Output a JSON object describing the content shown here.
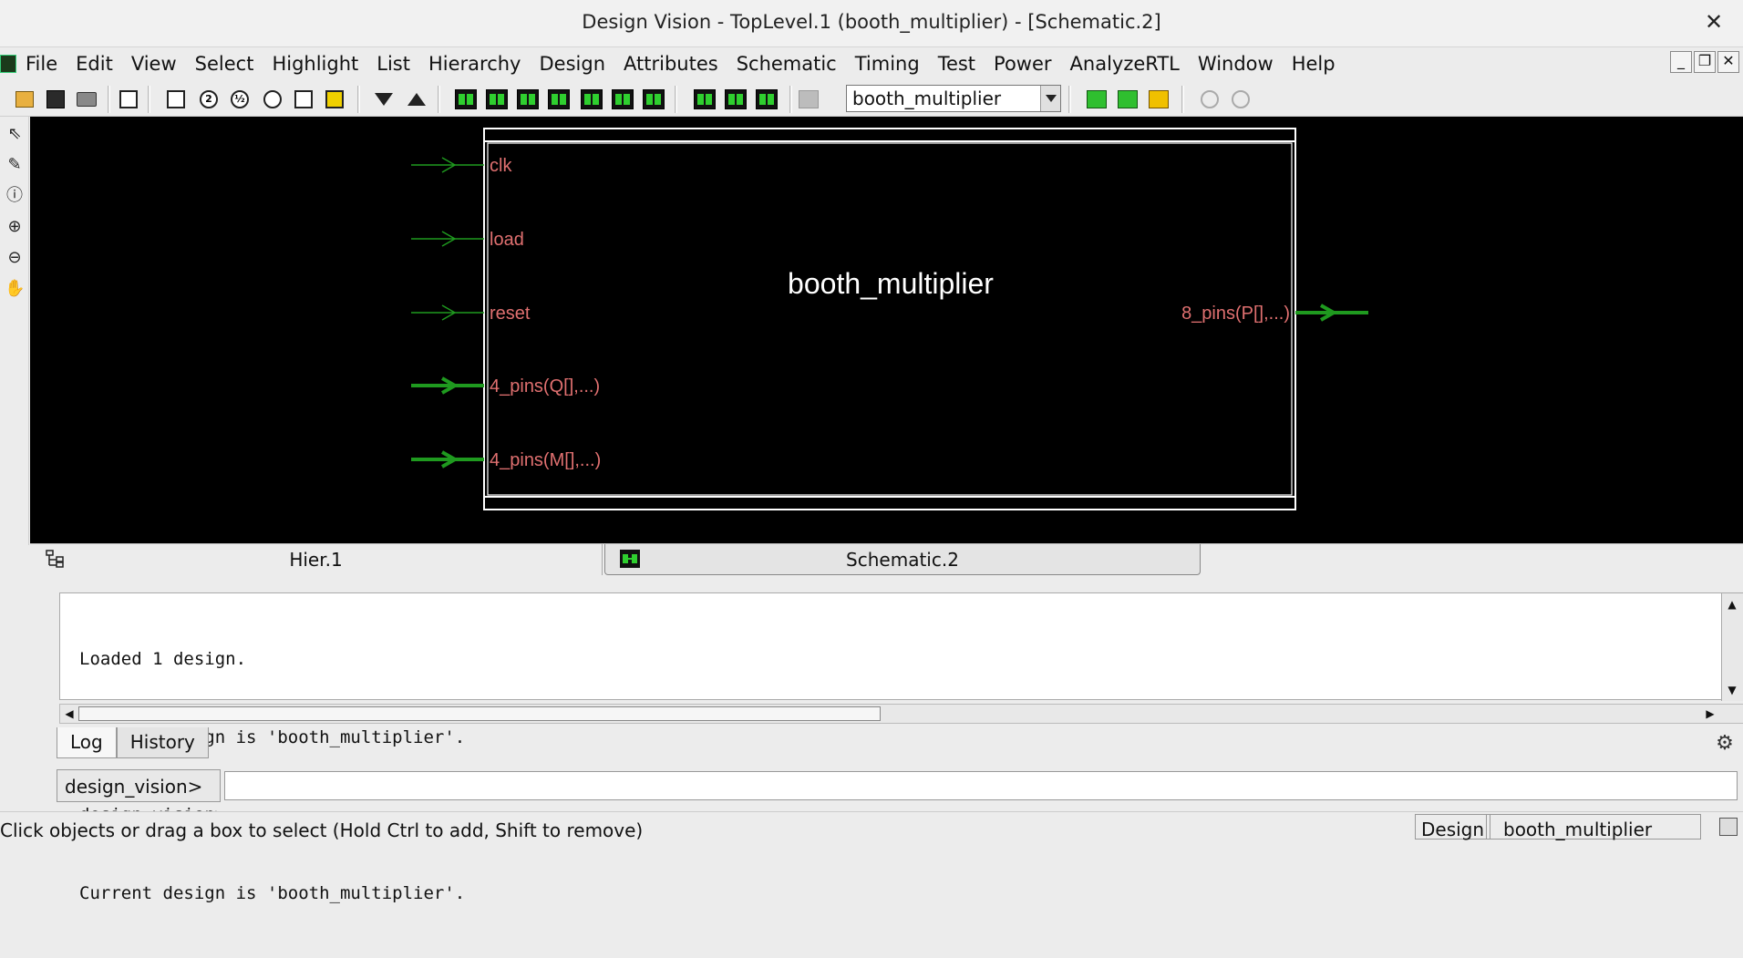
{
  "window": {
    "title": "Design Vision - TopLevel.1 (booth_multiplier) - [Schematic.2]",
    "close_glyph": "✕"
  },
  "menubar": {
    "items": [
      {
        "label": "File"
      },
      {
        "label": "Edit"
      },
      {
        "label": "View"
      },
      {
        "label": "Select"
      },
      {
        "label": "Highlight"
      },
      {
        "label": "List"
      },
      {
        "label": "Hierarchy"
      },
      {
        "label": "Design"
      },
      {
        "label": "Attributes"
      },
      {
        "label": "Schematic"
      },
      {
        "label": "Timing"
      },
      {
        "label": "Test"
      },
      {
        "label": "Power"
      },
      {
        "label": "AnalyzeRTL"
      },
      {
        "label": "Window"
      },
      {
        "label": "Help"
      }
    ],
    "mdi": {
      "minimize": "_",
      "restore": "❐",
      "close": "✕"
    }
  },
  "toolbar": {
    "design_select_value": "booth_multiplier"
  },
  "left_toolbar": {
    "icons": [
      "select-arrow-icon",
      "pencil-icon",
      "info-icon",
      "zoom-in-icon",
      "zoom-out-icon",
      "pan-hand-icon"
    ]
  },
  "schematic": {
    "block_name": "booth_multiplier",
    "inputs": [
      {
        "label": "clk",
        "bus": false
      },
      {
        "label": "load",
        "bus": false
      },
      {
        "label": "reset",
        "bus": false
      },
      {
        "label": "4_pins(Q[],...)",
        "bus": true
      },
      {
        "label": "4_pins(M[],...)",
        "bus": true
      }
    ],
    "outputs": [
      {
        "label": "8_pins(P[],...)",
        "bus": true
      }
    ],
    "colors": {
      "background": "#000000",
      "block_border": "#ffffff",
      "pin_label": "#e07070",
      "wire": "#1f9a1f",
      "block_name": "#ffffff"
    }
  },
  "view_tabs": {
    "hier": "Hier.1",
    "schematic": "Schematic.2"
  },
  "console": {
    "lines": [
      "Loaded 1 design.",
      "Current design is 'booth_multiplier'.",
      "design_vision>",
      "Current design is 'booth_multiplier'."
    ]
  },
  "log_tabs": {
    "log": "Log",
    "history": "History"
  },
  "command": {
    "prompt_label": "design_vision>",
    "input_value": ""
  },
  "statusbar": {
    "message": "Click objects or drag a box to select (Hold Ctrl to add, Shift to remove)",
    "design_label": "Design",
    "design_value": "booth_multiplier"
  }
}
